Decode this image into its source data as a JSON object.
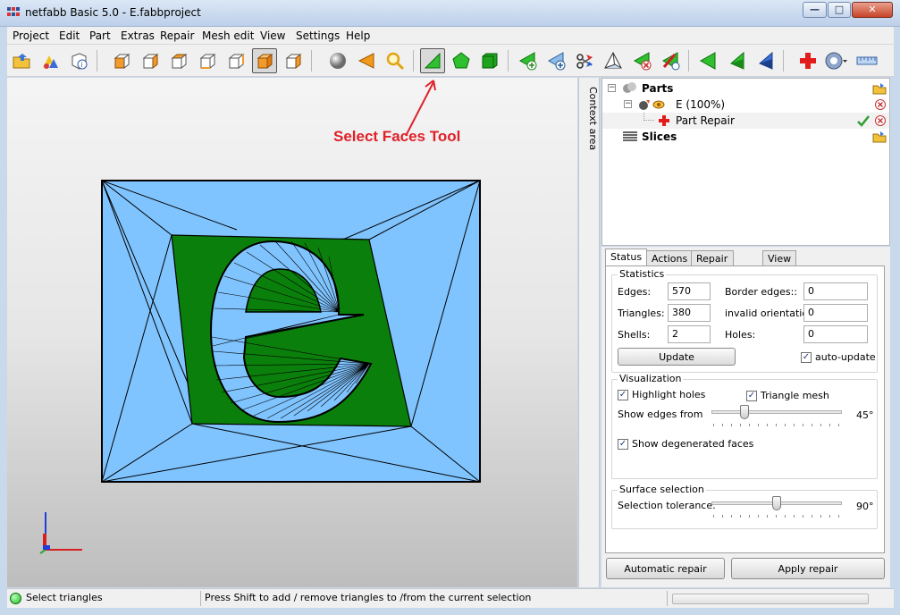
{
  "window": {
    "title": "netfabb Basic 5.0 - E.fabbproject",
    "minimize_glyph": "—",
    "maximize_glyph": "□",
    "close_glyph": "✕"
  },
  "menu": [
    "Project",
    "Edit",
    "Part",
    "Extras",
    "Repair",
    "Mesh edit",
    "View",
    "Settings",
    "Help"
  ],
  "toolbar_icons": [
    "open-icon",
    "add-part-icon",
    "part-info-icon",
    "view-front-icon",
    "view-back-icon",
    "view-left-icon",
    "view-right-icon",
    "view-top-icon",
    "view-bottom-icon",
    "view-iso-icon",
    "render-sphere-icon",
    "select-triangle-icon",
    "select-zoom-icon",
    "select-faces-icon",
    "select-shells-icon",
    "select-parts-icon",
    "add-triangle-icon",
    "add-triangle-2-icon",
    "cut-icon",
    "measure-icon",
    "remove-triangle-icon",
    "flip-icon",
    "move-left-icon",
    "move-center-icon",
    "move-right-icon",
    "repair-cross-icon",
    "gear-menu-icon",
    "ruler-icon"
  ],
  "annotation": {
    "text": "Select Faces Tool",
    "color": "#e0202a"
  },
  "context_area": {
    "label": "Context area"
  },
  "tree": {
    "parts_label": "Parts",
    "part_label": "E (100%)",
    "repair_label": "Part Repair",
    "slices_label": "Slices"
  },
  "tabs": [
    "Status",
    "Actions",
    "Repair scripts",
    "View"
  ],
  "statistics": {
    "title": "Statistics",
    "edges_label": "Edges:",
    "edges": "570",
    "border_edges_label": "Border edges::",
    "border_edges": "0",
    "triangles_label": "Triangles:",
    "triangles": "380",
    "invalid_label": "invalid orientation:",
    "invalid": "0",
    "shells_label": "Shells:",
    "shells": "2",
    "holes_label": "Holes:",
    "holes": "0",
    "update_label": "Update",
    "auto_update_label": "auto-update"
  },
  "visualization": {
    "title": "Visualization",
    "highlight_holes_label": "Highlight holes",
    "triangle_mesh_label": "Triangle mesh",
    "show_edges_label": "Show edges from",
    "show_edges_value": "45°",
    "show_edges_fraction": 0.25,
    "degenerated_label": "Show degenerated faces"
  },
  "surface_selection": {
    "title": "Surface selection",
    "tolerance_label": "Selection tolerance:",
    "tolerance_value": "90°",
    "tolerance_fraction": 0.5
  },
  "buttons": {
    "automatic_repair": "Automatic repair",
    "apply_repair": "Apply repair"
  },
  "status": {
    "mode": "Select triangles",
    "hint": "Press Shift to add / remove triangles to /from the current selection"
  },
  "colors": {
    "selected_face": "#0b7f0b",
    "unselected_face": "#80c4ff",
    "accent": "#2f9e2f"
  }
}
